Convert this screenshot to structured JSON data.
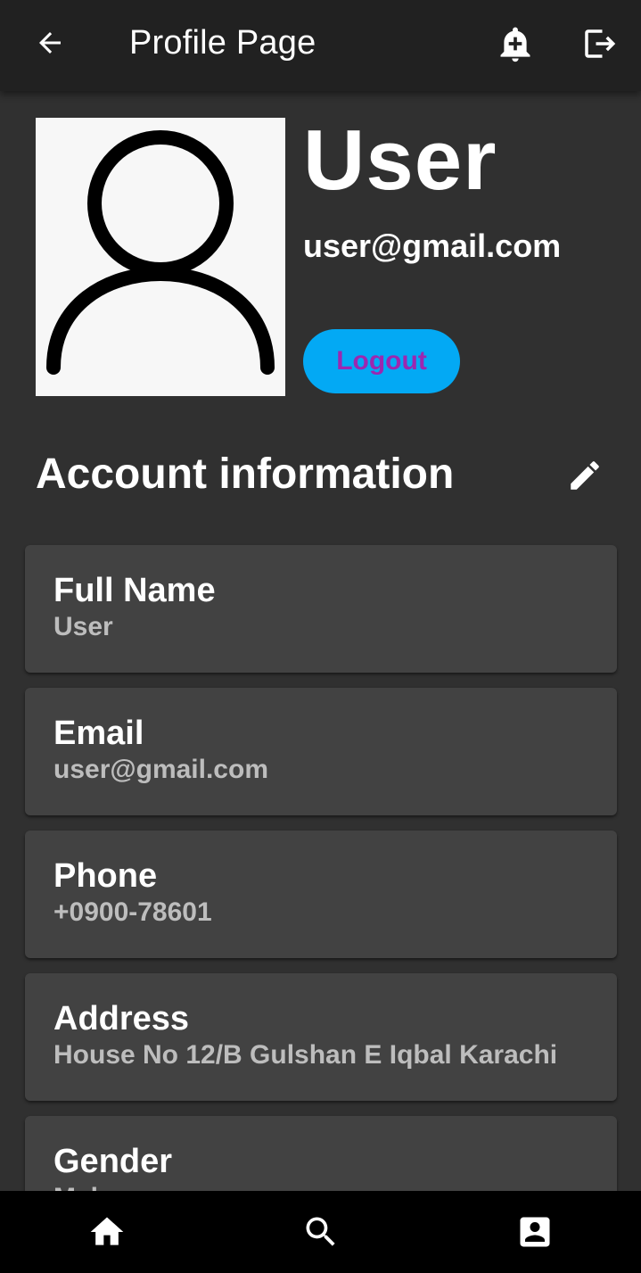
{
  "appbar": {
    "title": "Profile Page",
    "back_icon": "arrow-back-icon",
    "notify_icon": "add-alert-icon",
    "exit_icon": "exit-to-app-icon"
  },
  "profile": {
    "name": "User",
    "email": "user@gmail.com",
    "logout_label": "Logout",
    "avatar_icon": "person-outline-icon"
  },
  "account": {
    "title": "Account information",
    "edit_icon": "edit-pencil-icon",
    "fields": [
      {
        "label": "Full Name",
        "value": "User"
      },
      {
        "label": "Email",
        "value": "user@gmail.com"
      },
      {
        "label": "Phone",
        "value": "+0900-78601"
      },
      {
        "label": "Address",
        "value": "House No 12/B Gulshan E Iqbal Karachi"
      },
      {
        "label": "Gender",
        "value": "Male"
      }
    ]
  },
  "bottom_nav": {
    "items": [
      "home-icon",
      "search-icon",
      "account-box-icon"
    ]
  },
  "colors": {
    "background": "#303030",
    "appbar": "#212121",
    "card": "#424242",
    "accent_button": "#03a9f4",
    "button_text": "#9c27b0",
    "nav": "#000000"
  }
}
